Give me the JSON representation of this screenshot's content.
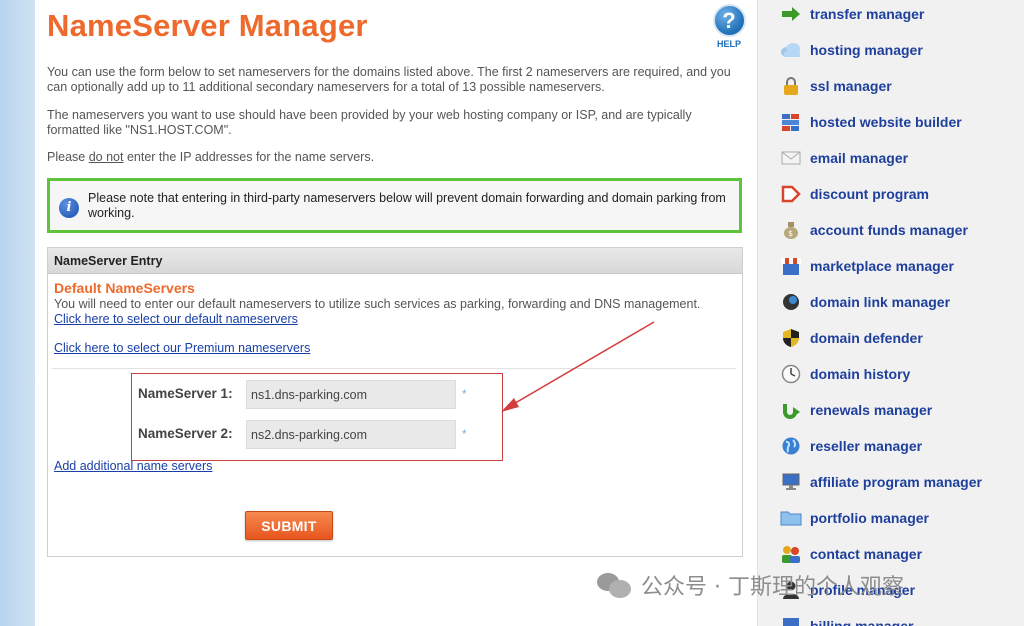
{
  "page": {
    "title": "NameServer Manager",
    "help_label": "HELP",
    "help_glyph": "?"
  },
  "intro": {
    "p1": "You can use the form below to set nameservers for the domains listed above. The first 2 nameservers are required, and you can optionally add up to 11 additional secondary nameservers for a total of 13 possible nameservers.",
    "p2": "The nameservers you want to use should have been provided by your web hosting company or ISP, and are typically formatted like \"NS1.HOST.COM\".",
    "p3_before": "Please ",
    "p3_emph": "do not",
    "p3_after": " enter the IP addresses for the name servers."
  },
  "notice": {
    "icon": "info-icon",
    "text": "Please note that entering in third-party nameservers below will prevent domain forwarding and domain parking from working."
  },
  "panel": {
    "header": "NameServer Entry",
    "default_title": "Default NameServers",
    "default_desc": "You will need to enter our default nameservers to utilize such services as parking, forwarding and DNS management.",
    "default_link": "Click here to select our default nameservers",
    "premium_link": "Click here to select our Premium nameservers",
    "ns1_label": "NameServer 1:",
    "ns1_value": "ns1.dns-parking.com",
    "ns2_label": "NameServer 2:",
    "ns2_value": "ns2.dns-parking.com",
    "required_mark": "*",
    "add_link": "Add additional name servers",
    "submit_label": "SUBMIT"
  },
  "sidebar": {
    "items": [
      {
        "label": "transfer manager",
        "icon": "arrow-right-icon"
      },
      {
        "label": "hosting manager",
        "icon": "cloud-icon"
      },
      {
        "label": "ssl manager",
        "icon": "lock-icon"
      },
      {
        "label": "hosted website builder",
        "icon": "blocks-icon"
      },
      {
        "label": "email manager",
        "icon": "envelope-icon"
      },
      {
        "label": "discount program",
        "icon": "tag-icon"
      },
      {
        "label": "account funds manager",
        "icon": "money-bag-icon"
      },
      {
        "label": "marketplace manager",
        "icon": "storefront-icon"
      },
      {
        "label": "domain link manager",
        "icon": "globe-link-icon"
      },
      {
        "label": "domain defender",
        "icon": "shield-icon"
      },
      {
        "label": "domain history",
        "icon": "clock-icon"
      },
      {
        "label": "renewals manager",
        "icon": "renew-arrow-icon"
      },
      {
        "label": "reseller manager",
        "icon": "globe-icon"
      },
      {
        "label": "affiliate program manager",
        "icon": "monitor-icon"
      },
      {
        "label": "portfolio manager",
        "icon": "folder-icon"
      },
      {
        "label": "contact manager",
        "icon": "contacts-icon"
      },
      {
        "label": "profile manager",
        "icon": "person-icon"
      },
      {
        "label": "billing manager",
        "icon": "billing-icon"
      }
    ]
  },
  "watermark": {
    "text": "公众号 · 丁斯理的个人观察"
  },
  "colors": {
    "title_orange": "#ee6a2c",
    "link_blue": "#1a3fa8",
    "sidebar_blue": "#1e3f9c",
    "notice_green": "#5ec43b",
    "annotation_red": "#c94040"
  }
}
